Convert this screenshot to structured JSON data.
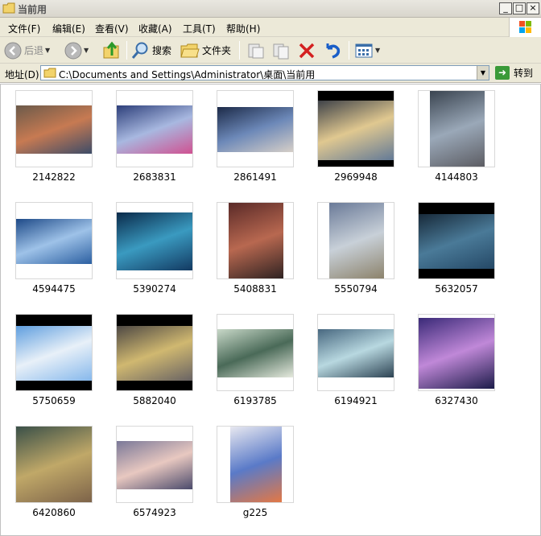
{
  "window": {
    "title": "当前用",
    "minimize_label": "_",
    "maximize_label": "□",
    "close_label": "×"
  },
  "menu": {
    "items": [
      "文件(F)",
      "编辑(E)",
      "查看(V)",
      "收藏(A)",
      "工具(T)",
      "帮助(H)"
    ]
  },
  "toolbar": {
    "back_label": "后退",
    "search_label": "搜索",
    "folders_label": "文件夹"
  },
  "address": {
    "label": "地址(D)",
    "path": "C:\\Documents and Settings\\Administrator\\桌面\\当前用",
    "go_label": "转到"
  },
  "files": [
    {
      "name": "2142822",
      "colors": [
        "#6b5a4a",
        "#c77a52",
        "#3b4b68"
      ]
    },
    {
      "name": "2683831",
      "colors": [
        "#2d3f7a",
        "#a8b8e0",
        "#d05090"
      ]
    },
    {
      "name": "2861491",
      "colors": [
        "#1c2a48",
        "#6c88b8",
        "#d8d0c8"
      ]
    },
    {
      "name": "2969948",
      "colors": [
        "#1a2438",
        "#e0c890",
        "#4a6a98"
      ]
    },
    {
      "name": "4144803",
      "colors": [
        "#3a4450",
        "#9aa8b8",
        "#5a5a60"
      ]
    },
    {
      "name": "4594475",
      "colors": [
        "#1e4a88",
        "#9ec2e8",
        "#2a5ea0"
      ]
    },
    {
      "name": "5390274",
      "colors": [
        "#0a2a4a",
        "#3a9ac0",
        "#123860"
      ]
    },
    {
      "name": "5408831",
      "colors": [
        "#5a2a28",
        "#b86850",
        "#2a2020"
      ]
    },
    {
      "name": "5550794",
      "colors": [
        "#6a7a98",
        "#c8d0d8",
        "#8a8068"
      ]
    },
    {
      "name": "5632057",
      "colors": [
        "#0a1420",
        "#4a7a98",
        "#1a3a58"
      ]
    },
    {
      "name": "5750659",
      "colors": [
        "#3a88d8",
        "#e8f0f8",
        "#6aa8e8"
      ]
    },
    {
      "name": "5882040",
      "colors": [
        "#2a2a38",
        "#d0b870",
        "#4a4a60"
      ]
    },
    {
      "name": "6193785",
      "colors": [
        "#c8d8c8",
        "#4a6a58",
        "#e8ece0"
      ]
    },
    {
      "name": "6194921",
      "colors": [
        "#486880",
        "#b8d8e0",
        "#2a4050"
      ]
    },
    {
      "name": "6327430",
      "colors": [
        "#3a2a78",
        "#c088d8",
        "#1a1a48"
      ]
    },
    {
      "name": "6420860",
      "colors": [
        "#3a5048",
        "#c0a868",
        "#7a6048"
      ]
    },
    {
      "name": "6574923",
      "colors": [
        "#7a7898",
        "#e8c8c0",
        "#48486a"
      ]
    },
    {
      "name": "g225",
      "colors": [
        "#e8e8f0",
        "#5a7ac8",
        "#e87840"
      ]
    }
  ]
}
